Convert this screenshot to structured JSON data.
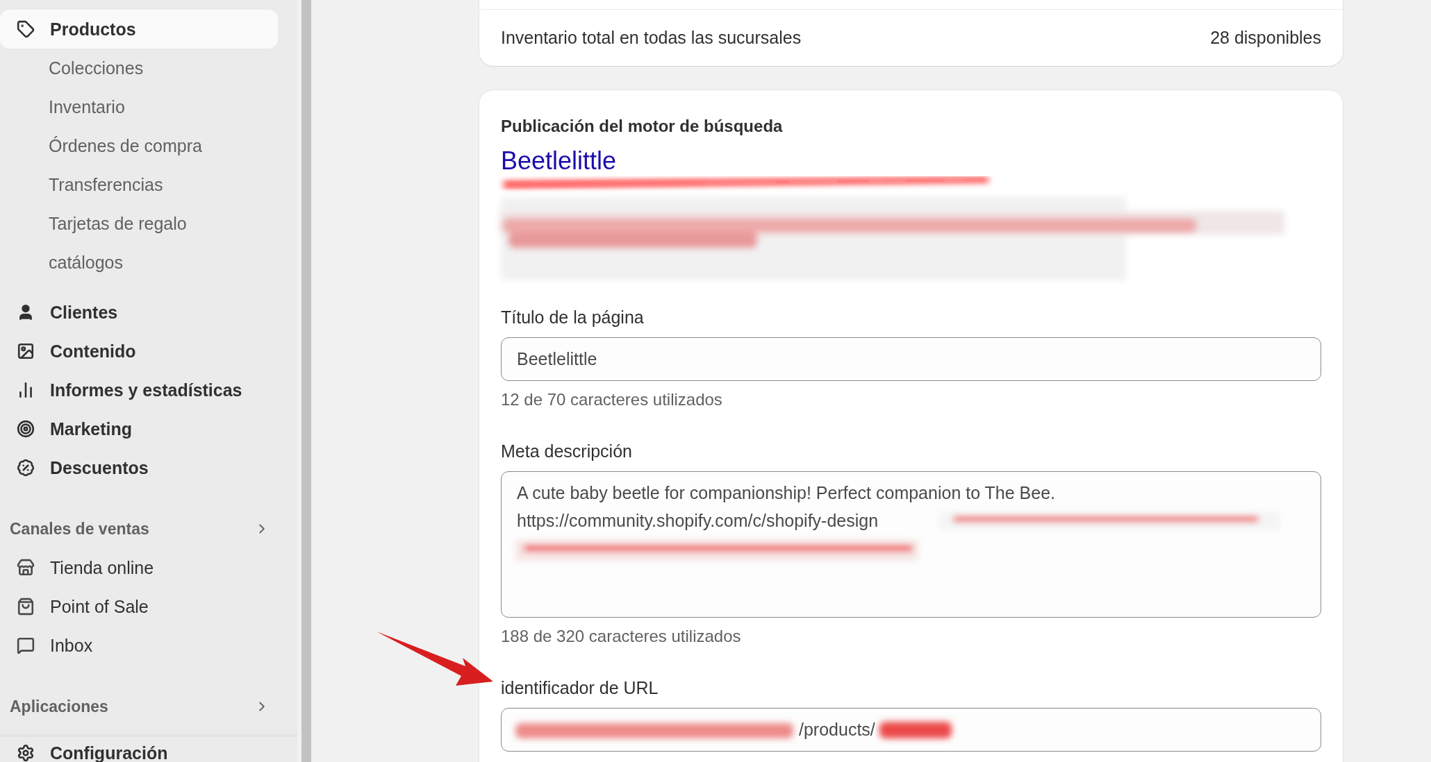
{
  "sidebar": {
    "nav": [
      {
        "label": "Productos",
        "selected": true,
        "children": [
          {
            "label": "Colecciones",
            "selected": false
          },
          {
            "label": "Inventario",
            "selected": false
          },
          {
            "label": "Órdenes de compra",
            "selected": false
          },
          {
            "label": "Transferencias",
            "selected": false
          },
          {
            "label": "Tarjetas de regalo",
            "selected": false
          },
          {
            "label": "catálogos",
            "selected": false
          }
        ]
      },
      {
        "label": "Clientes",
        "selected": false
      },
      {
        "label": "Contenido",
        "selected": false
      },
      {
        "label": "Informes y estadísticas",
        "selected": false
      },
      {
        "label": "Marketing",
        "selected": false
      },
      {
        "label": "Descuentos",
        "selected": false
      }
    ],
    "sections": [
      {
        "title": "Canales de ventas",
        "items": [
          {
            "label": "Tienda online",
            "selected": false
          },
          {
            "label": "Point of Sale",
            "selected": false
          },
          {
            "label": "Inbox",
            "selected": false
          }
        ]
      },
      {
        "title": "Aplicaciones"
      }
    ],
    "settings": {
      "label": "Configuración"
    }
  },
  "inventory": {
    "label": "Inventario total en todas las sucursales",
    "value": "28 disponibles"
  },
  "seo": {
    "title": "Publicación del motor de búsqueda",
    "preview_title": "Beetlelittle",
    "fields": [
      {
        "kind": "input",
        "label": "Título de la página",
        "value": "Beetlelittle",
        "hint": "12 de 70 caracteres utilizados"
      },
      {
        "kind": "textarea",
        "label": "Meta descripción",
        "lines": [
          "A cute baby beetle for companionship! Perfect companion to The Bee.",
          "https://community.shopify.com/c/shopify-design"
        ],
        "hint": "188 de 320 caracteres utilizados"
      },
      {
        "kind": "url",
        "label": "identificador de URL",
        "value": "/products/"
      }
    ]
  }
}
